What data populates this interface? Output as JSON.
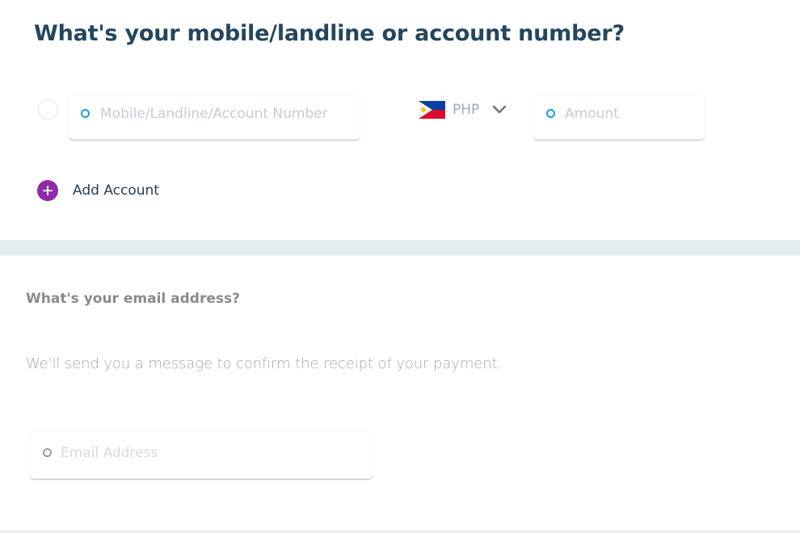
{
  "account_section": {
    "title": "What's your mobile/landline or account number?",
    "mobile_field": {
      "placeholder": "Mobile/Landline/Account Number",
      "value": ""
    },
    "currency": {
      "flag": "philippines-flag-icon",
      "code": "PHP"
    },
    "amount_field": {
      "placeholder": "Amount",
      "value": ""
    },
    "add_account_label": "Add Account"
  },
  "email_section": {
    "title": "What's your email address?",
    "description": "We'll send you a message to confirm the receipt of your payment.",
    "email_field": {
      "placeholder": "Email Address",
      "value": ""
    }
  },
  "colors": {
    "title": "#24465e",
    "focus_dot": "#1a9be0",
    "add_button": "#8e2ba8",
    "section_divider": "#e3ebef"
  }
}
